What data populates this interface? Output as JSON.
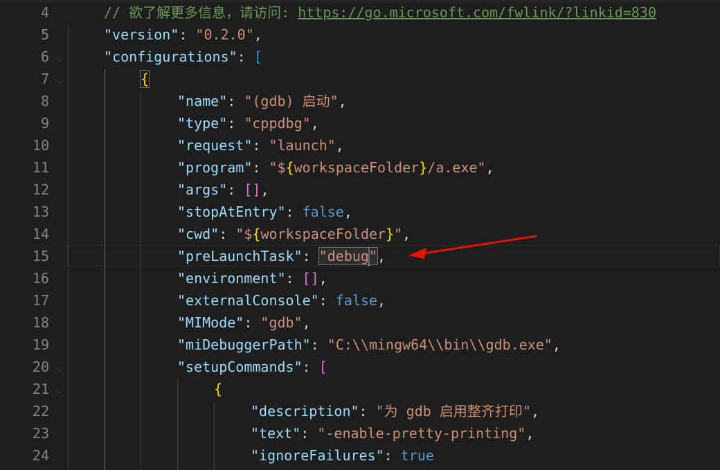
{
  "editor": {
    "lines": [
      {
        "num": "4",
        "tokens": [
          {
            "t": "// 欲了解更多信息，请访问: ",
            "c": "c"
          },
          {
            "t": "https://go.microsoft.com/fwlink/?linkid=830",
            "c": "link"
          }
        ]
      },
      {
        "num": "5",
        "tokens": [
          {
            "t": "\"version\"",
            "c": "k"
          },
          {
            "t": ": ",
            "c": "p"
          },
          {
            "t": "\"0.2.0\"",
            "c": "s"
          },
          {
            "t": ",",
            "c": "p"
          }
        ]
      },
      {
        "num": "6",
        "tokens": [
          {
            "t": "\"configurations\"",
            "c": "k"
          },
          {
            "t": ": ",
            "c": "p"
          },
          {
            "t": "[",
            "c": "br-b"
          }
        ]
      },
      {
        "num": "7",
        "tokens": [
          {
            "t": "{",
            "c": "br-y box-brace"
          }
        ]
      },
      {
        "num": "8",
        "tokens": [
          {
            "t": "\"name\"",
            "c": "k"
          },
          {
            "t": ": ",
            "c": "p"
          },
          {
            "t": "\"(gdb) 启动\"",
            "c": "s"
          },
          {
            "t": ",",
            "c": "p"
          }
        ]
      },
      {
        "num": "9",
        "tokens": [
          {
            "t": "\"type\"",
            "c": "k"
          },
          {
            "t": ": ",
            "c": "p"
          },
          {
            "t": "\"cppdbg\"",
            "c": "s"
          },
          {
            "t": ",",
            "c": "p"
          }
        ]
      },
      {
        "num": "10",
        "tokens": [
          {
            "t": "\"request\"",
            "c": "k"
          },
          {
            "t": ": ",
            "c": "p"
          },
          {
            "t": "\"launch\"",
            "c": "s"
          },
          {
            "t": ",",
            "c": "p"
          }
        ]
      },
      {
        "num": "11",
        "tokens": [
          {
            "t": "\"program\"",
            "c": "k"
          },
          {
            "t": ": ",
            "c": "p"
          },
          {
            "t": "\"$",
            "c": "s"
          },
          {
            "t": "{",
            "c": "br-y"
          },
          {
            "t": "workspaceFolder",
            "c": "s"
          },
          {
            "t": "}",
            "c": "br-y"
          },
          {
            "t": "/a.exe\"",
            "c": "s"
          },
          {
            "t": ",",
            "c": "p"
          }
        ]
      },
      {
        "num": "12",
        "tokens": [
          {
            "t": "\"args\"",
            "c": "k"
          },
          {
            "t": ": ",
            "c": "p"
          },
          {
            "t": "[]",
            "c": "br-p"
          },
          {
            "t": ",",
            "c": "p"
          }
        ]
      },
      {
        "num": "13",
        "tokens": [
          {
            "t": "\"stopAtEntry\"",
            "c": "k"
          },
          {
            "t": ": ",
            "c": "p"
          },
          {
            "t": "false",
            "c": "b"
          },
          {
            "t": ",",
            "c": "p"
          }
        ]
      },
      {
        "num": "14",
        "tokens": [
          {
            "t": "\"cwd\"",
            "c": "k"
          },
          {
            "t": ": ",
            "c": "p"
          },
          {
            "t": "\"$",
            "c": "s"
          },
          {
            "t": "{",
            "c": "br-y"
          },
          {
            "t": "workspaceFolder",
            "c": "s"
          },
          {
            "t": "}",
            "c": "br-y"
          },
          {
            "t": "\"",
            "c": "s"
          },
          {
            "t": ",",
            "c": "p"
          }
        ]
      },
      {
        "num": "15",
        "current": true,
        "tokens": [
          {
            "t": "\"preLaunchTask\"",
            "c": "k"
          },
          {
            "t": ": ",
            "c": "p"
          },
          {
            "t": "\"debug",
            "c": "s hl"
          },
          {
            "t": "",
            "c": "cursor"
          },
          {
            "t": "\"",
            "c": "s hl"
          },
          {
            "t": ",",
            "c": "p"
          }
        ]
      },
      {
        "num": "16",
        "tokens": [
          {
            "t": "\"environment\"",
            "c": "k"
          },
          {
            "t": ": ",
            "c": "p"
          },
          {
            "t": "[]",
            "c": "br-p"
          },
          {
            "t": ",",
            "c": "p"
          }
        ]
      },
      {
        "num": "17",
        "tokens": [
          {
            "t": "\"externalConsole\"",
            "c": "k"
          },
          {
            "t": ": ",
            "c": "p"
          },
          {
            "t": "false",
            "c": "b"
          },
          {
            "t": ",",
            "c": "p"
          }
        ]
      },
      {
        "num": "18",
        "tokens": [
          {
            "t": "\"MIMode\"",
            "c": "k"
          },
          {
            "t": ": ",
            "c": "p"
          },
          {
            "t": "\"gdb\"",
            "c": "s"
          },
          {
            "t": ",",
            "c": "p"
          }
        ]
      },
      {
        "num": "19",
        "tokens": [
          {
            "t": "\"miDebuggerPath\"",
            "c": "k"
          },
          {
            "t": ": ",
            "c": "p"
          },
          {
            "t": "\"C:\\\\mingw64\\\\bin\\\\gdb.exe\"",
            "c": "s"
          },
          {
            "t": ",",
            "c": "p"
          }
        ]
      },
      {
        "num": "20",
        "tokens": [
          {
            "t": "\"setupCommands\"",
            "c": "k"
          },
          {
            "t": ": ",
            "c": "p"
          },
          {
            "t": "[",
            "c": "br-p"
          }
        ]
      },
      {
        "num": "21",
        "tokens": [
          {
            "t": "{",
            "c": "br-y"
          }
        ]
      },
      {
        "num": "22",
        "tokens": [
          {
            "t": "\"description\"",
            "c": "k"
          },
          {
            "t": ": ",
            "c": "p"
          },
          {
            "t": "\"为 gdb 启用整齐打印\"",
            "c": "s"
          },
          {
            "t": ",",
            "c": "p"
          }
        ]
      },
      {
        "num": "23",
        "tokens": [
          {
            "t": "\"text\"",
            "c": "k"
          },
          {
            "t": ": ",
            "c": "p"
          },
          {
            "t": "\"-enable-pretty-printing\"",
            "c": "s"
          },
          {
            "t": ",",
            "c": "p"
          }
        ]
      },
      {
        "num": "24",
        "tokens": [
          {
            "t": "\"ignoreFailures\"",
            "c": "k"
          },
          {
            "t": ": ",
            "c": "p"
          },
          {
            "t": "true",
            "c": "b"
          }
        ]
      }
    ]
  },
  "colors": {
    "background": "#1e1e1e",
    "line_number": "#858585",
    "key": "#9cdcfe",
    "string": "#ce9178",
    "comment": "#6a9955",
    "keyword": "#569cd6",
    "arrow": "#e51400"
  },
  "annotation": {
    "icon": "red-arrow-icon"
  }
}
